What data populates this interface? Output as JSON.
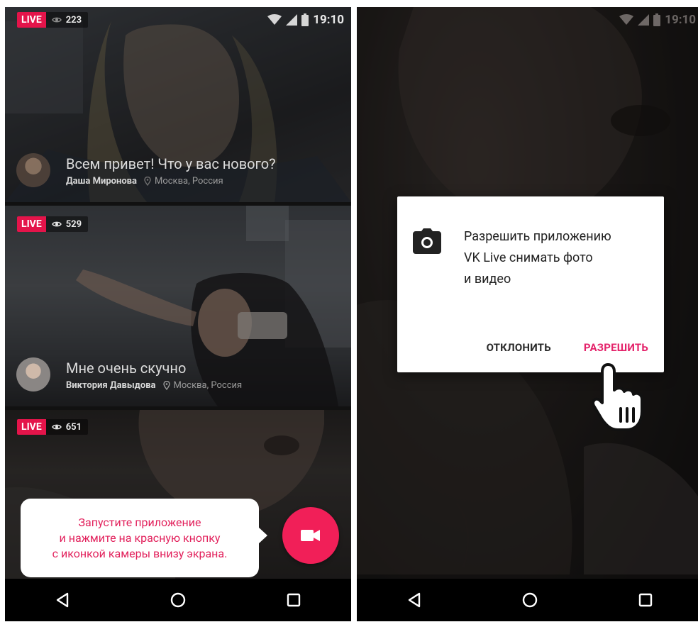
{
  "left_screen": {
    "status": {
      "time": "19:10"
    },
    "streams": [
      {
        "live": "LIVE",
        "viewers": "223",
        "message": "Всем привет! Что у вас нового?",
        "author": "Даша Миронова",
        "location": "Москва, Россия"
      },
      {
        "live": "LIVE",
        "viewers": "529",
        "message": "Мне очень скучно",
        "author": "Виктория Давыдова",
        "location": "Москва, Россия"
      },
      {
        "live": "LIVE",
        "viewers": "651"
      }
    ],
    "tooltip": {
      "lines": [
        "Запустите приложение",
        "и нажмите на красную кнопку",
        "с иконкой камеры внизу экрана."
      ]
    },
    "fab": {
      "icon": "video-camera-icon"
    }
  },
  "right_screen": {
    "status": {
      "time": "19:10"
    },
    "dialog": {
      "icon": "camera-icon",
      "message_lines": [
        "Разрешить приложению",
        "VK Live снимать фото",
        "и видео"
      ],
      "deny": "ОТКЛОНИТЬ",
      "allow": "РАЗРЕШИТЬ"
    }
  },
  "navigation": {
    "icons": [
      "back-icon",
      "home-icon",
      "recents-icon"
    ]
  },
  "colors": {
    "accent": "#f11f58",
    "live_badge": "#e4144a",
    "allow_text": "#e4226a",
    "tooltip_text": "#e2215c"
  }
}
